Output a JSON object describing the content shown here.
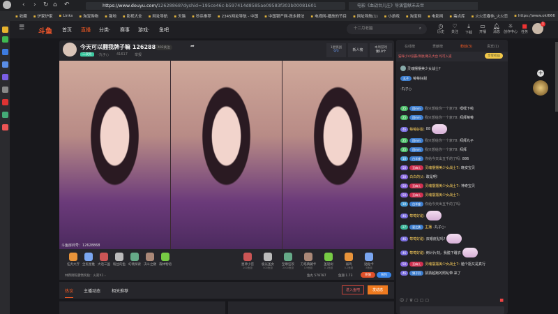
{
  "browser": {
    "url_host": "https://www.douyu.com/",
    "url_rest": "12628868?dyshid=195ce46c-b597414d8585ae09583f303b00081601",
    "search_box": "电影《血战台儿庄》导演雷献禾去世",
    "bookmarks": [
      "收藏",
      "炉家炉家",
      "Links",
      "淘宝购物",
      "锄地",
      "影视大全",
      "网址导航",
      "天猫",
      "秒杀推荐",
      "2345网址导航 - 中国",
      "中国银产网-政永择法",
      "电视网-播放的节目",
      "网址导航(1)",
      "小游戏",
      "淘宝网",
      "电影网",
      "斋点库",
      "火火恋春伟_火火恋",
      "https://www.okl666"
    ]
  },
  "header": {
    "logo": "斗鱼",
    "nav": [
      "首页",
      "直播",
      "分类·",
      "赛事",
      "游戏·",
      "鱼吧"
    ],
    "search_placeholder": "十二月老鼬",
    "tools": [
      "历史",
      "关注",
      "下载",
      "开播",
      "消息",
      "创作中心",
      "任务"
    ],
    "badge": "1"
  },
  "stream": {
    "title": "今天可以翻我牌子嘛 12628868",
    "followers": "402关注",
    "tag": "二次元",
    "anchor": "-丸子○",
    "hot": "41617",
    "report": "举报",
    "box1_label": "1星挑战",
    "box1_value": "0/3",
    "box2": "新人榜",
    "box3_label": "本周游戏",
    "box3_value": "领10个",
    "room_id": "斗鱼房间号：12628868"
  },
  "gifts_left": [
    "任务大厅",
    "全民星推",
    "大话三国",
    "粉丝的鱼",
    "幻境探索",
    "决斗之巅",
    "森林物语"
  ],
  "gifts_right": [
    {
      "name": "星神小宫",
      "price": "100鱼翅"
    },
    {
      "name": "极光圣女",
      "price": "500鱼翅"
    },
    {
      "name": "至尊狂欢",
      "price": "2000鱼翅"
    },
    {
      "name": "刀塔典藏卡",
      "price": "0.9鱼翅"
    },
    {
      "name": "圣诞树",
      "price": "0.1鱼翅"
    },
    {
      "name": "弱鸡",
      "price": "0.2鱼翅"
    },
    {
      "name": "贴贴卡",
      "price": "8鱼翅"
    }
  ],
  "info": {
    "reward": "林霖阴陈震惰奖励：火箭X1 ›",
    "fishball": "鱼丸 578787",
    "fishfin": "鱼翅 1.73",
    "charge": "充值",
    "backpack": "背包"
  },
  "tabs": [
    "热议",
    "主播动态",
    "相关推荐"
  ],
  "tab_buttons": [
    "进入鱼吧",
    "发动态"
  ],
  "chat": {
    "tabs": [
      "在线榜",
      "贡献榜",
      "粉丝(3)",
      "贵宾(1)"
    ],
    "notice": "猫咪小V/波霸/高肽/路礼大台 均可入道",
    "notice_btn": "享受权益",
    "pinned": [
      {
        "name": "灵魂摆摆美少女战士?"
      },
      {
        "fan": "丸子",
        "text": "莓莓好甜"
      },
      {
        "text": "-丸子○"
      }
    ],
    "messages": [
      {
        "lv": "25",
        "fan": "团mm",
        "name": "我只想给你一个家78:",
        "text": "嘿嘿下啦"
      },
      {
        "lv": "25",
        "fan": "团mm",
        "name": "我只想给你一个家78:",
        "text": "拜拜莓莓"
      },
      {
        "lv": "46",
        "fan": "",
        "name": "莓莓好甜:",
        "text": "88",
        "emo": true
      },
      {
        "lv": "25",
        "fan": "团mm",
        "name": "我只想给你一个家78:",
        "text": "拜拜丸子"
      },
      {
        "lv": "25",
        "fan": "团mm",
        "name": "我只想给你一个家78:",
        "text": "拜拜"
      },
      {
        "lv": "10",
        "fan": "白羊座",
        "name": "你给今天出五千的了吗:",
        "text": "886"
      },
      {
        "lv": "50",
        "fan": "至麻儿",
        "name": "灵魂摆摆美少女战士7:",
        "text": "晚安宝贝"
      },
      {
        "lv": "30",
        "fan": "",
        "name": "白白的父:",
        "text": "敢是啊!"
      },
      {
        "lv": "50",
        "fan": "至麻儿",
        "name": "灵魂摆摆美少女战士7:",
        "text": "神奇宝贝"
      },
      {
        "lv": "50",
        "fan": "至麻儿",
        "name": "灵魂摆摆美少女战士7:",
        "text": ""
      },
      {
        "lv": "10",
        "fan": "白羊座",
        "name": "你给今天出五千的了吗:",
        "text": ""
      },
      {
        "lv": "46",
        "fan": "",
        "name": "莓莓好甜:",
        "text": "",
        "emo": true
      },
      {
        "lv": "27",
        "fan": "星之勇",
        "name": "主播",
        "text": "-丸子○:"
      },
      {
        "lv": "46",
        "fan": "",
        "name": "莓莓好甜:",
        "text": "双眼皮贴吗?",
        "emo": true
      },
      {
        "lv": "46",
        "fan": "",
        "name": "莓莓好甜:",
        "text": "倒计片刻，我脱下睡衣",
        "emo": true
      },
      {
        "lv": "50",
        "fan": "至麻儿",
        "name": "灵魂摆摆美少女战士7:",
        "text": "脑个瓶又是真行"
      },
      {
        "lv": "46",
        "fan": "狮子羽",
        "name": "",
        "text": "猜猜超跑的照乱带 来了"
      }
    ]
  }
}
